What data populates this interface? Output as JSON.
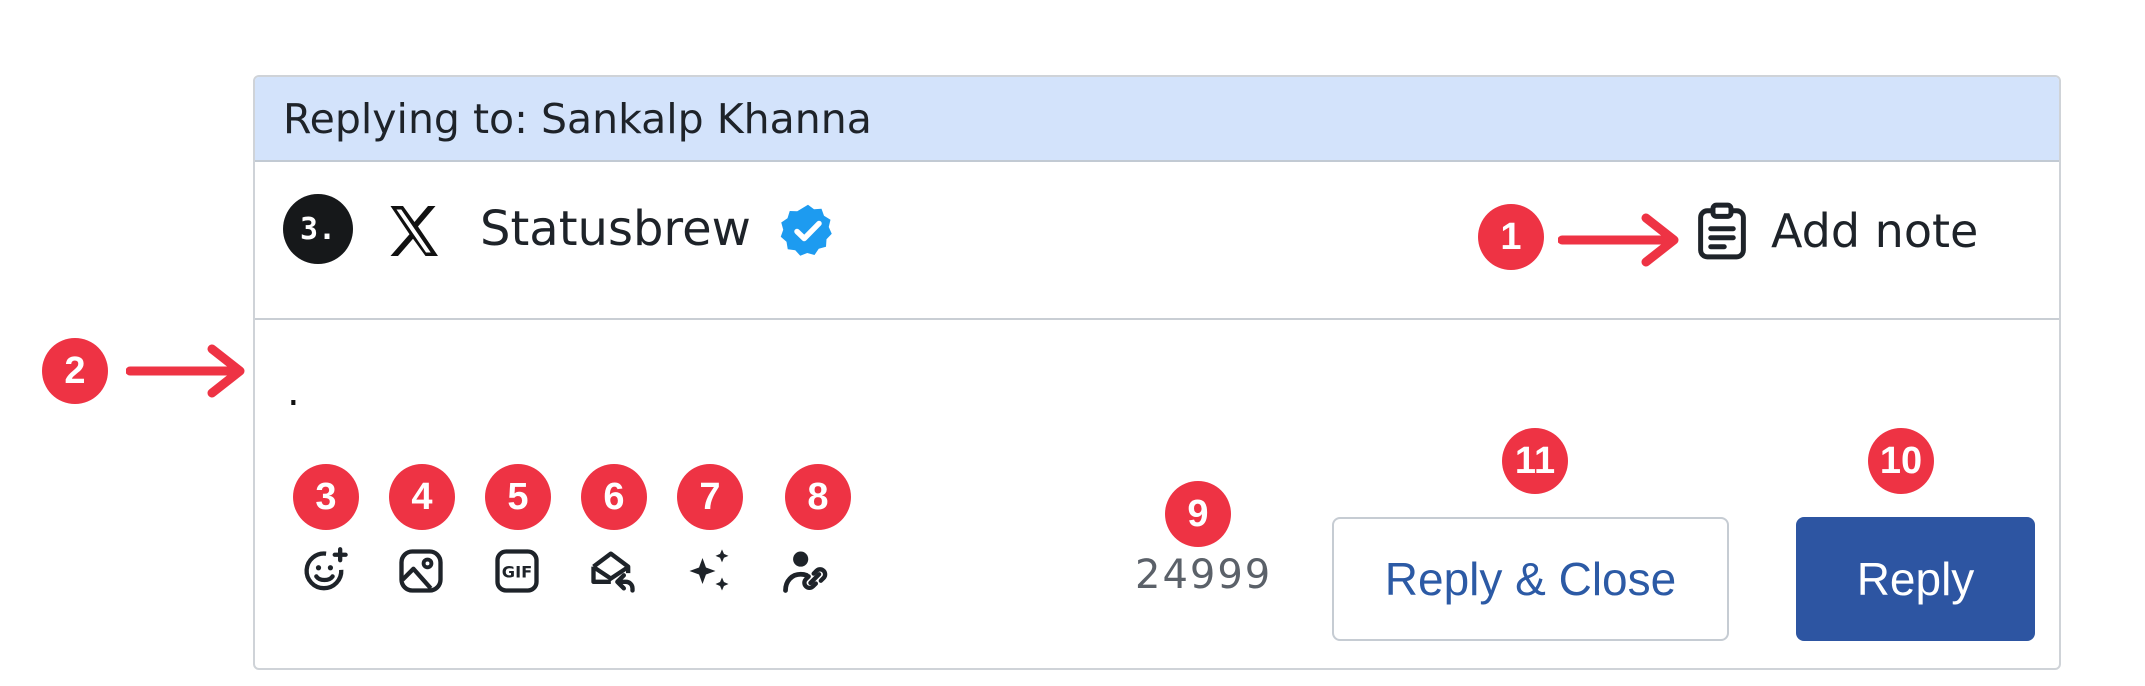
{
  "reply_bar": {
    "text": "Replying to: Sankalp Khanna"
  },
  "account": {
    "avatar_glyph": "3.",
    "network": "x-logo-icon",
    "name": "Statusbrew",
    "verified": "verified-badge-icon"
  },
  "note": {
    "label": "Add note",
    "icon": "clipboard-icon"
  },
  "composer": {
    "text": "."
  },
  "toolbar": {
    "tools": [
      {
        "name": "emoji-icon"
      },
      {
        "name": "image-icon"
      },
      {
        "name": "gif-icon"
      },
      {
        "name": "reply-envelope-icon"
      },
      {
        "name": "ai-sparkles-icon"
      },
      {
        "name": "user-link-icon"
      }
    ]
  },
  "counter": {
    "value": "24999"
  },
  "buttons": {
    "reply_close": "Reply & Close",
    "reply": "Reply"
  },
  "annotations": [
    "1",
    "2",
    "3",
    "4",
    "5",
    "6",
    "7",
    "8",
    "9",
    "10",
    "11"
  ],
  "colors": {
    "accent": "#2d55a2",
    "badge": "#ee3344",
    "reply_bar_bg": "#d3e3fb",
    "verified": "#1d9bf0"
  }
}
